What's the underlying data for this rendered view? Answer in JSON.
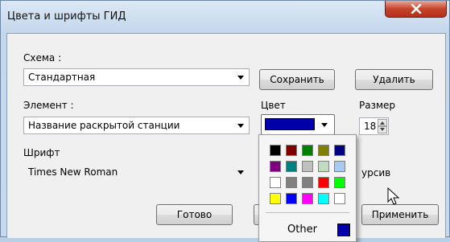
{
  "window": {
    "title": "Цвета и шрифты ГИД"
  },
  "scheme": {
    "label": "Схема :",
    "value": "Стандартная",
    "save": "Сохранить",
    "delete": "Удалить"
  },
  "element": {
    "label": "Элемент :",
    "value": "Название раскрытой станции"
  },
  "color": {
    "label": "Цвет",
    "selected": "#0000a8"
  },
  "size": {
    "label": "Размер",
    "value": "18"
  },
  "font": {
    "label": "Шрифт",
    "value": "Times New Roman"
  },
  "italic": {
    "label": "Курсив",
    "visible_fragment": "урсив"
  },
  "buttons": {
    "ok": "Готово",
    "apply": "Применить"
  },
  "palette": {
    "rows": [
      [
        "#000000",
        "#800000",
        "#008000",
        "#808000",
        "#000080"
      ],
      [
        "#800080",
        "#008080",
        "#c0c0c0",
        "#c0dcc0",
        "#a6caf0"
      ],
      [
        "#ffffff",
        "#808080",
        "#808080",
        "#ff0000",
        "#00ff00"
      ],
      [
        "#ffff00",
        "#0000ff",
        "#ff00ff",
        "#00ffff",
        "#ffffff"
      ]
    ],
    "other_label": "Other",
    "other_color": "#0000a8"
  }
}
